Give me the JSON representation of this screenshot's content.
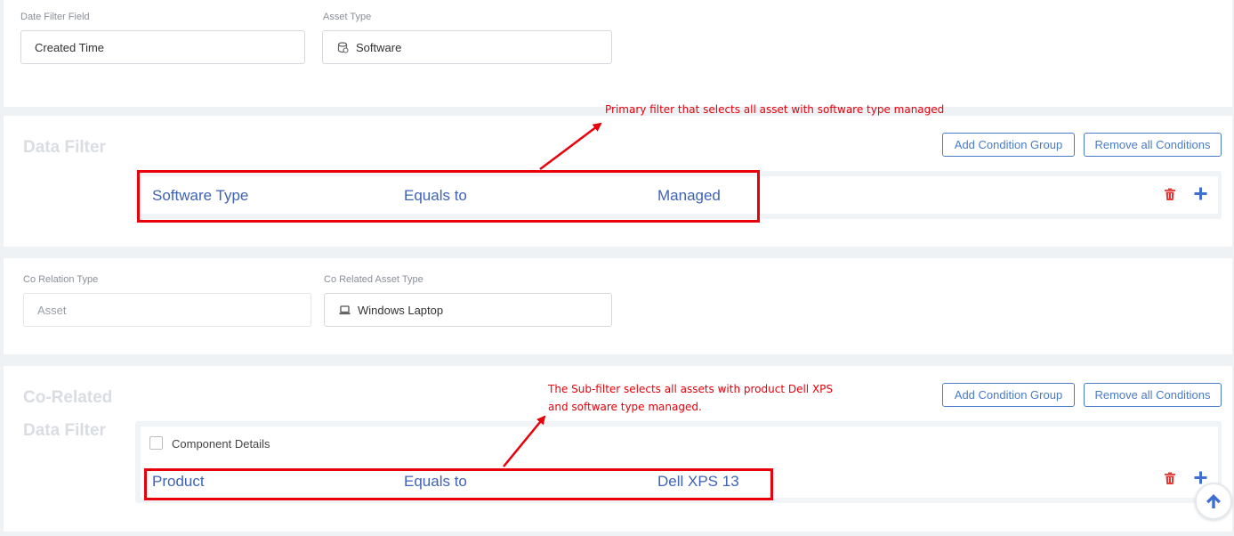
{
  "date_filter": {
    "label": "Date Filter Field",
    "value": "Created Time"
  },
  "asset_type": {
    "label": "Asset Type",
    "value": "Software",
    "icon": "software-icon"
  },
  "data_filter": {
    "title": "Data Filter",
    "add_group_label": "Add Condition Group",
    "remove_all_label": "Remove all Conditions",
    "condition": {
      "field": "Software Type",
      "operator": "Equals to",
      "value": "Managed"
    }
  },
  "co_relation": {
    "type_label": "Co Relation Type",
    "type_value": "Asset",
    "asset_type_label": "Co Related Asset Type",
    "asset_type_value": "Windows Laptop",
    "asset_type_icon": "laptop-icon"
  },
  "co_related_filter": {
    "title_line1": "Co-Related",
    "title_line2": "Data Filter",
    "add_group_label": "Add Condition Group",
    "remove_all_label": "Remove all Conditions",
    "checkbox_label": "Component Details",
    "checkbox_checked": false,
    "condition": {
      "field": "Product",
      "operator": "Equals to",
      "value": "Dell XPS 13"
    }
  },
  "annotations": {
    "primary": "Primary filter that selects all asset with software type managed",
    "sub_line1": "The Sub-filter selects all assets with product Dell XPS",
    "sub_line2": "and software type managed.",
    "color": "#e8000b"
  },
  "colors": {
    "accent": "#4a7bc8",
    "condition_text": "#3f63b5",
    "danger": "#e53935"
  }
}
